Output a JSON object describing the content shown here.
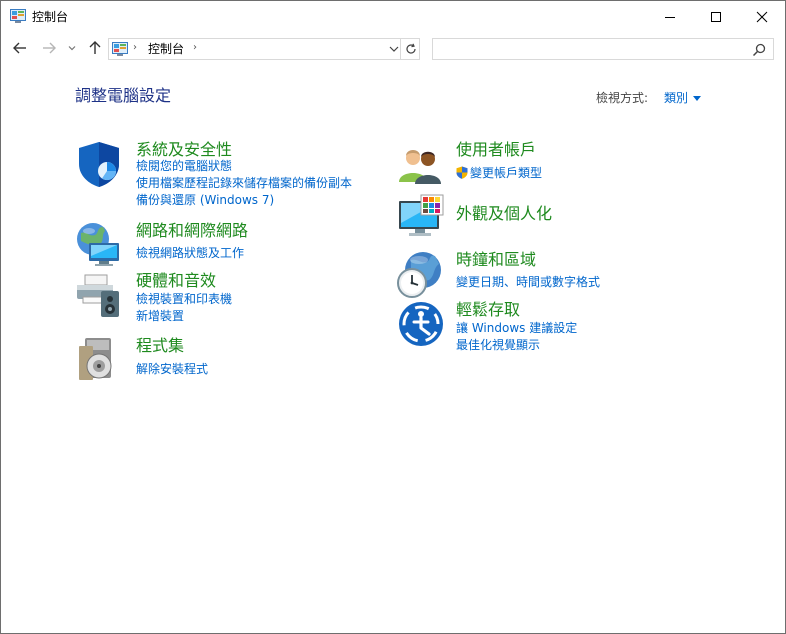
{
  "window": {
    "title": "控制台",
    "controls": {
      "minimize": "minimize",
      "maximize": "maximize",
      "close": "close"
    }
  },
  "nav": {
    "back_icon": "arrow-left-icon",
    "forward_icon": "arrow-right-icon",
    "recent_icon": "chevron-down-icon",
    "up_icon": "arrow-up-icon"
  },
  "address": {
    "separator": "›",
    "path": "控制台",
    "trailing_separator": "›",
    "refresh_icon": "refresh-icon"
  },
  "search": {
    "value": "",
    "placeholder": ""
  },
  "main": {
    "title": "調整電腦設定",
    "view_by_label": "檢視方式:",
    "view_by_value": "類別"
  },
  "categories_left": [
    {
      "title": "系統及安全性",
      "icon": "security-shield-icon",
      "links": [
        "檢閱您的電腦狀態",
        "使用檔案歷程記錄來儲存檔案的備份副本",
        "備份與還原 (Windows 7)"
      ]
    },
    {
      "title": "網路和網際網路",
      "icon": "network-globe-icon",
      "links": [
        "檢視網路狀態及工作"
      ]
    },
    {
      "title": "硬體和音效",
      "icon": "printer-speaker-icon",
      "links": [
        "檢視裝置和印表機",
        "新增裝置"
      ]
    },
    {
      "title": "程式集",
      "icon": "programs-disc-icon",
      "links": [
        "解除安裝程式"
      ]
    }
  ],
  "categories_right": [
    {
      "title": "使用者帳戶",
      "icon": "users-icon",
      "links": [
        "變更帳戶類型"
      ]
    },
    {
      "title": "外觀及個人化",
      "icon": "monitor-palette-icon",
      "links": []
    },
    {
      "title": "時鐘和區域",
      "icon": "clock-globe-icon",
      "links": [
        "變更日期、時間或數字格式"
      ]
    },
    {
      "title": "輕鬆存取",
      "icon": "ease-of-access-icon",
      "links": [
        "讓 Windows 建議設定",
        "最佳化視覺顯示"
      ]
    }
  ],
  "colors": {
    "category_title": "#1e8a1e",
    "link": "#0066cc",
    "page_title": "#1e3287"
  }
}
